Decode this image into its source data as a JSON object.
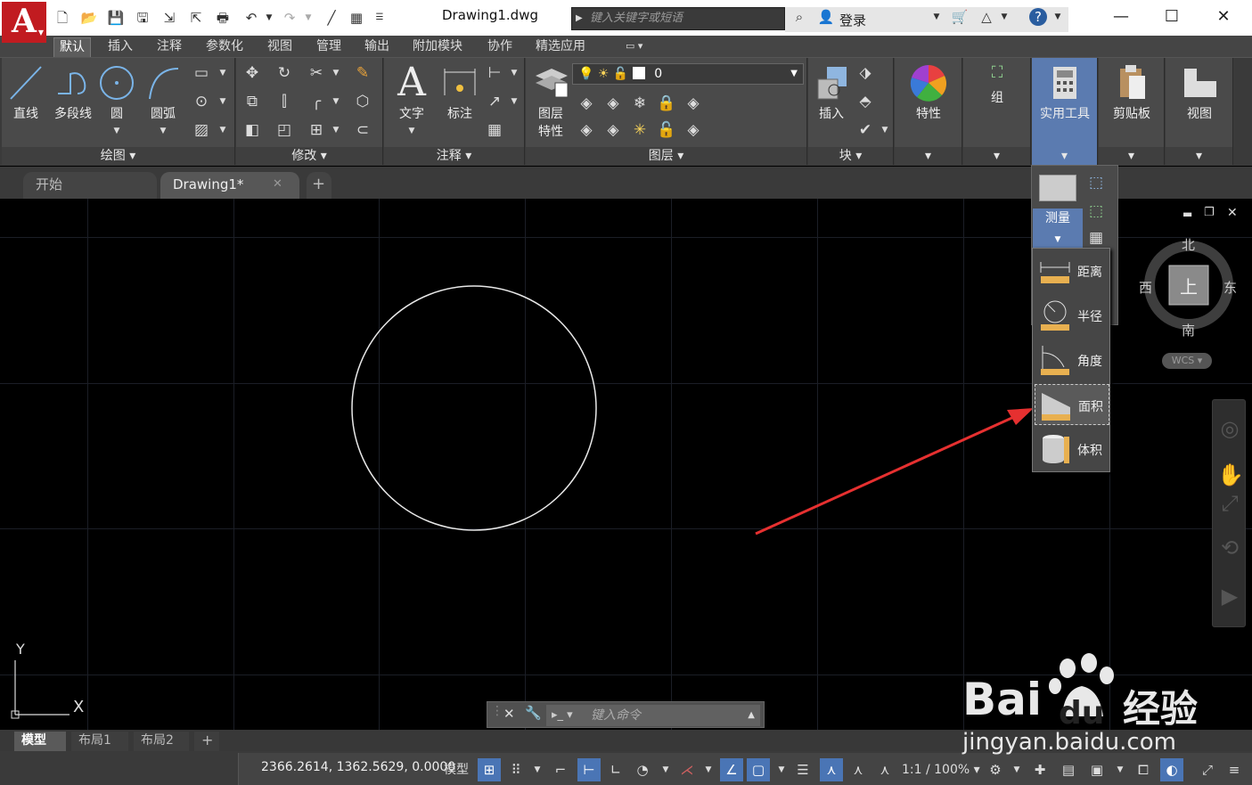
{
  "app": {
    "logo_letter": "A",
    "document_title": "Drawing1.dwg",
    "search_placeholder": "键入关键字或短语",
    "login_label": "登录"
  },
  "ribbon_tabs": [
    "默认",
    "插入",
    "注释",
    "参数化",
    "视图",
    "管理",
    "输出",
    "附加模块",
    "协作",
    "精选应用"
  ],
  "ribbon": {
    "draw": {
      "title": "绘图",
      "line": "直线",
      "polyline": "多段线",
      "circle": "圆",
      "arc": "圆弧"
    },
    "modify": {
      "title": "修改"
    },
    "annotation": {
      "title": "注释",
      "text": "文字",
      "dimension": "标注"
    },
    "layers": {
      "title": "图层",
      "properties_line1": "图层",
      "properties_line2": "特性",
      "current_layer": "0"
    },
    "block": {
      "title": "块",
      "insert": "插入"
    },
    "properties": {
      "label": "特性"
    },
    "group": {
      "label": "组"
    },
    "utilities": {
      "label": "实用工具"
    },
    "clipboard": {
      "label": "剪贴板"
    },
    "view": {
      "label": "视图"
    }
  },
  "file_tabs": [
    "开始",
    "Drawing1*"
  ],
  "utilities_dropdown": {
    "measure_label": "测量",
    "items": [
      "距离",
      "半径",
      "角度",
      "面积",
      "体积"
    ],
    "selected": "面积"
  },
  "viewcube": {
    "north": "北",
    "south": "南",
    "east": "东",
    "west": "西",
    "face": "上",
    "wcs": "WCS"
  },
  "ucs": {
    "x": "X",
    "y": "Y"
  },
  "command_line": {
    "placeholder": "键入命令"
  },
  "layout_tabs": [
    "模型",
    "布局1",
    "布局2"
  ],
  "status": {
    "coordinates": "2366.2614, 1362.5629, 0.0000",
    "model_label": "模型",
    "scale": "1:1 / 100%"
  },
  "watermark": {
    "brand": "Bai",
    "brand_cn": "经验",
    "url": "jingyan.baidu.com"
  }
}
